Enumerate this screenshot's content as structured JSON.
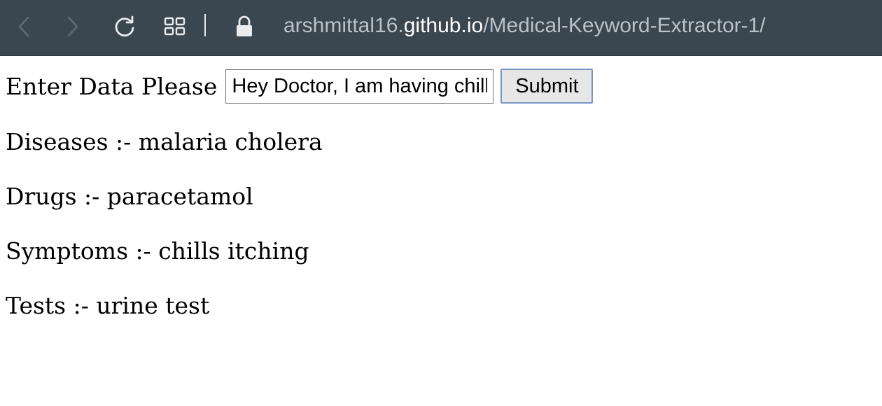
{
  "browser": {
    "url_prefix": "arshmittal16.",
    "url_domain": "github.io",
    "url_path": "/Medical-Keyword-Extractor-1/",
    "icons": [
      "back-icon",
      "forward-icon",
      "reload-icon",
      "tabs-grid-icon",
      "lock-icon"
    ]
  },
  "form": {
    "label": "Enter Data Please",
    "input_value": "Hey Doctor, I am having chills and itching",
    "submit_label": "Submit"
  },
  "results": [
    {
      "text": "Diseases :- malaria cholera"
    },
    {
      "text": "Drugs :- paracetamol"
    },
    {
      "text": "Symptoms :- chills itching"
    },
    {
      "text": "Tests :- urine test"
    }
  ],
  "colors": {
    "toolbar_bg": "#3a4650",
    "url_dim": "#b9c2c9",
    "url_bright": "#ffffff"
  }
}
